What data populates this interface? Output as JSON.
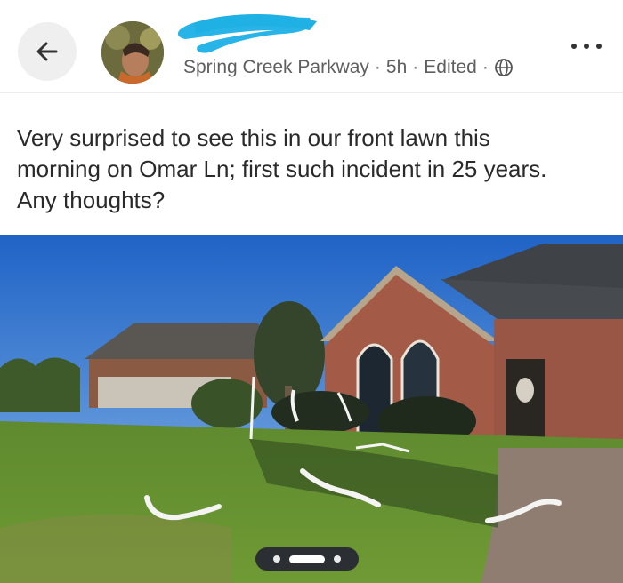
{
  "header": {
    "location": "Spring Creek Parkway",
    "time": "5h",
    "edited_label": "Edited",
    "separator": "·",
    "back_icon": "arrow-left-icon",
    "visibility_icon": "globe-icon",
    "more_icon": "more-horizontal-icon"
  },
  "post": {
    "line1": "Very surprised to see this in our front lawn this",
    "line2": "morning on Omar Ln; first such incident in 25 years.",
    "line3": "Any thoughts?"
  },
  "carousel": {
    "total_items": 3,
    "active_index": 2
  }
}
